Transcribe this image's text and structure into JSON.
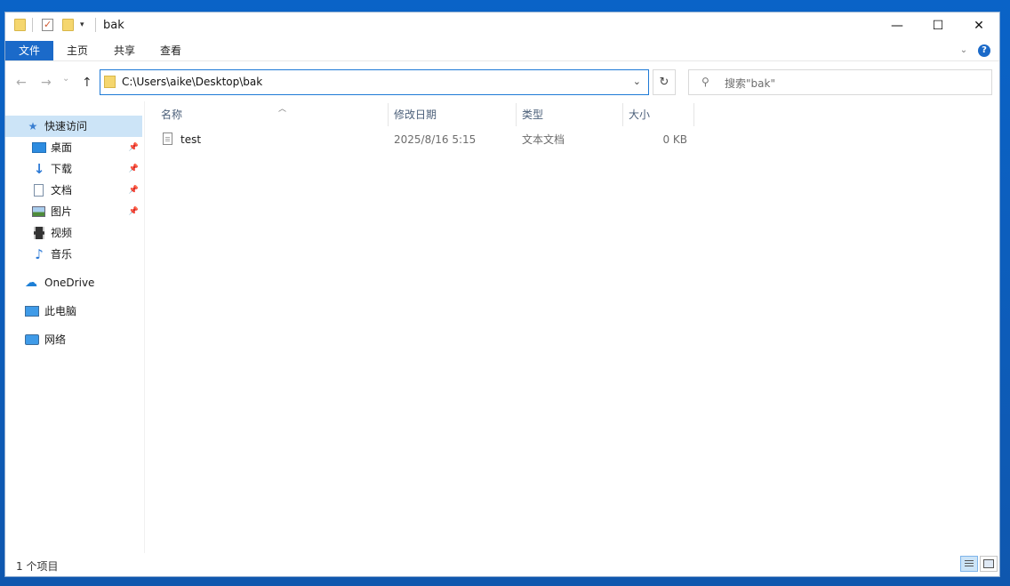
{
  "window": {
    "title": "bak"
  },
  "titlebar": {
    "minimize": "—",
    "maximize": "☐",
    "close": "✕"
  },
  "ribbon": {
    "tabs": [
      {
        "label": "文件"
      },
      {
        "label": "主页"
      },
      {
        "label": "共享"
      },
      {
        "label": "查看"
      }
    ]
  },
  "nav": {
    "back": "←",
    "forward": "→",
    "recent": "⌄",
    "up": "↑",
    "address": "C:\\Users\\aike\\Desktop\\bak",
    "refresh": "↻",
    "search_placeholder": "搜索\"bak\""
  },
  "sidebar": {
    "items": [
      {
        "label": "快速访问",
        "icon": "star-icon"
      },
      {
        "label": "桌面",
        "icon": "desktop-icon",
        "pinned": true
      },
      {
        "label": "下载",
        "icon": "download-icon",
        "pinned": true
      },
      {
        "label": "文档",
        "icon": "documents-icon",
        "pinned": true
      },
      {
        "label": "图片",
        "icon": "pictures-icon",
        "pinned": true
      },
      {
        "label": "视频",
        "icon": "videos-icon"
      },
      {
        "label": "音乐",
        "icon": "music-icon"
      },
      {
        "label": "OneDrive",
        "icon": "onedrive-icon"
      },
      {
        "label": "此电脑",
        "icon": "computer-icon"
      },
      {
        "label": "网络",
        "icon": "network-icon"
      }
    ]
  },
  "columns": [
    {
      "label": "名称"
    },
    {
      "label": "修改日期"
    },
    {
      "label": "类型"
    },
    {
      "label": "大小"
    }
  ],
  "files": [
    {
      "name": "test",
      "modified": "2025/8/16 5:15",
      "type": "文本文档",
      "size": "0 KB"
    }
  ],
  "status": {
    "count": "1 个项目"
  },
  "colors": {
    "accent": "#1b6ac9",
    "selection": "#cce4f7"
  }
}
